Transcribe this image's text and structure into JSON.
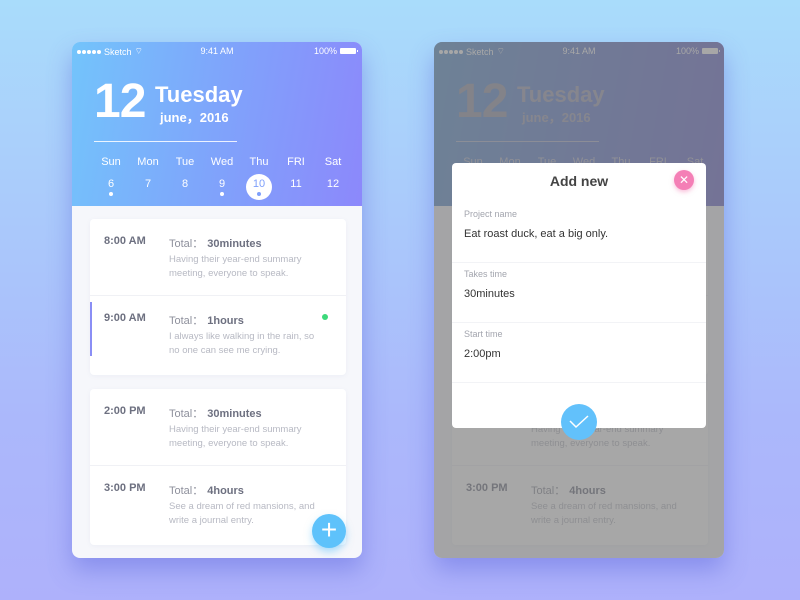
{
  "status_bar": {
    "carrier": "Sketch",
    "time": "9:41 AM",
    "battery": "100%"
  },
  "header": {
    "day": "12",
    "weekday": "Tuesday",
    "month_year": "june，2016"
  },
  "week": [
    {
      "name": "Sun",
      "num": "6",
      "has_event": true,
      "selected": false
    },
    {
      "name": "Mon",
      "num": "7",
      "has_event": false,
      "selected": false
    },
    {
      "name": "Tue",
      "num": "8",
      "has_event": false,
      "selected": false
    },
    {
      "name": "Wed",
      "num": "9",
      "has_event": true,
      "selected": false
    },
    {
      "name": "Thu",
      "num": "10",
      "has_event": true,
      "selected": true
    },
    {
      "name": "FRI",
      "num": "11",
      "has_event": false,
      "selected": false
    },
    {
      "name": "Sat",
      "num": "12",
      "has_event": false,
      "selected": false
    }
  ],
  "total_label": "Total：",
  "events": [
    {
      "time": "8:00 AM",
      "total": "30minutes",
      "desc": "Having their year-end summary meeting, everyone to speak."
    },
    {
      "time": "9:00 AM",
      "total": "1hours",
      "desc": "I always like walking in the rain, so no one can see me crying."
    },
    {
      "time": "2:00 PM",
      "total": "30minutes",
      "desc": "Having their year-end summary meeting, everyone to speak."
    },
    {
      "time": "3:00 PM",
      "total": "4hours",
      "desc": "See a dream of red mansions, and write a journal entry."
    }
  ],
  "fab": {
    "icon": "plus-icon",
    "symbol": "+"
  },
  "modal": {
    "title": "Add new",
    "close_symbol": "✕",
    "fields": [
      {
        "label": "Project name",
        "value": "Eat roast duck, eat a big only."
      },
      {
        "label": "Takes time",
        "value": "30minutes"
      },
      {
        "label": "Start time",
        "value": "2:00pm"
      }
    ]
  },
  "colors": {
    "accent": "#5ec2fb",
    "active_bar": "#8a8ef5",
    "status_green": "#3cd97a",
    "close_pink": "#f47fb6"
  }
}
